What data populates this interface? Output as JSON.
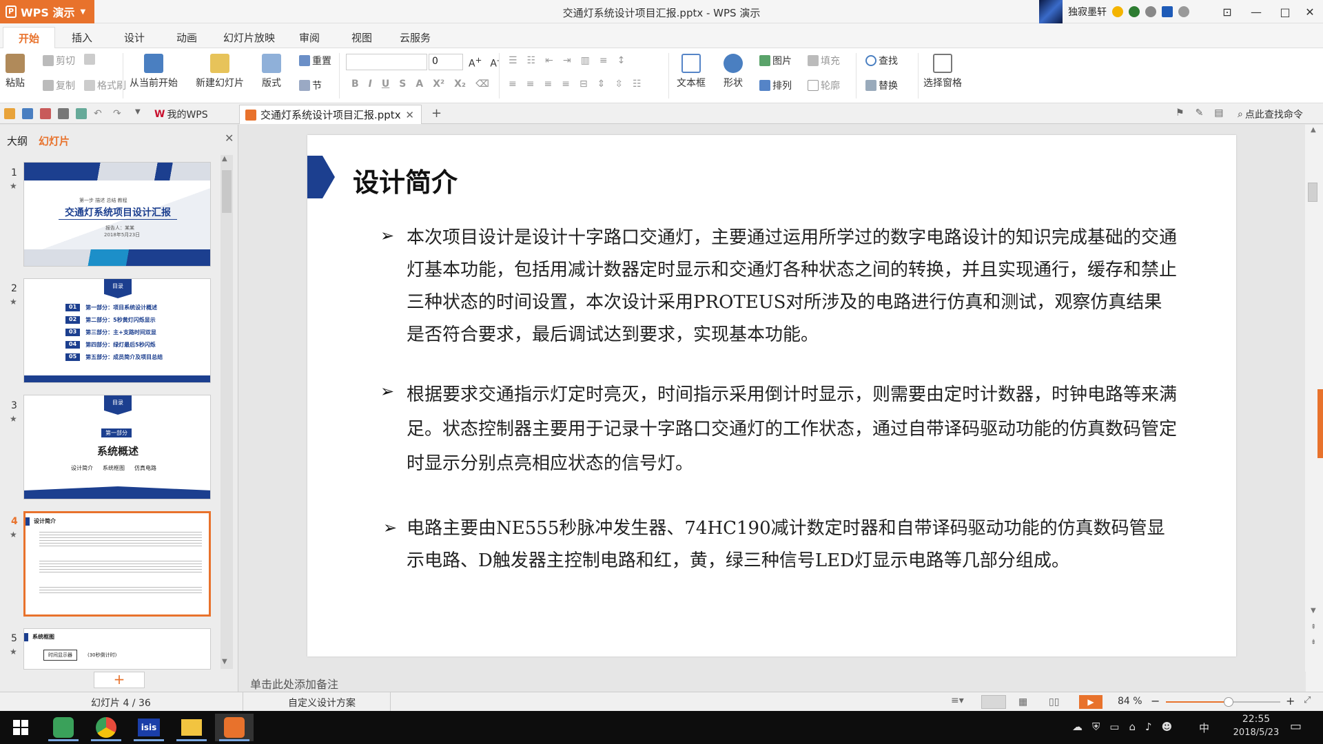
{
  "app": {
    "name": "WPS 演示",
    "window_title": "交通灯系统设计项目汇报.pptx - WPS 演示",
    "user": "独寂墨轩"
  },
  "colors": {
    "accent": "#e8722c",
    "slide_blue": "#1c3f8f"
  },
  "ribbon_tabs": [
    "开始",
    "插入",
    "设计",
    "动画",
    "幻灯片放映",
    "审阅",
    "视图",
    "云服务"
  ],
  "ribbon": {
    "paste": "粘贴",
    "cut": "剪切",
    "copy": "复制",
    "format_painter": "格式刷",
    "from_current": "从当前开始",
    "new_slide": "新建幻灯片",
    "layout": "版式",
    "reset": "重置",
    "section": "节",
    "font_size": "0",
    "text_box": "文本框",
    "shape": "形状",
    "picture": "图片",
    "fill": "填充",
    "arrange": "排列",
    "outline": "轮廓",
    "find": "查找",
    "replace": "替换",
    "selection_pane": "选择窗格"
  },
  "doc_tabs": {
    "home": "我的WPS",
    "current": "交通灯系统设计项目汇报.pptx",
    "search": "点此查找命令"
  },
  "panel": {
    "tab_outline": "大纲",
    "tab_slides": "幻灯片",
    "add": "+"
  },
  "thumbs": {
    "t1": {
      "title": "交通灯系统项目设计汇报",
      "sub": "第一步   描述   总结   教程",
      "info": "报告人：某某",
      "date": "2018年5月23日"
    },
    "t2": {
      "badge": "目录",
      "items": [
        {
          "n": "01",
          "t": "第一部分：项目系统设计概述"
        },
        {
          "n": "02",
          "t": "第二部分：5秒黄灯闪烁显示"
        },
        {
          "n": "03",
          "t": "第三部分：主+支路时间双显"
        },
        {
          "n": "04",
          "t": "第四部分：绿灯最后5秒闪烁"
        },
        {
          "n": "05",
          "t": "第五部分：成员简介及项目总结"
        }
      ]
    },
    "t3": {
      "badge": "目录",
      "part": "第一部分",
      "title": "系统概述",
      "items": [
        "设计简介",
        "系统框图",
        "仿真电路"
      ]
    },
    "t4": {
      "title": "设计简介"
    },
    "t5": {
      "title": "系统框图",
      "box": "时间显示器",
      "note": "(30秒倒计时)"
    }
  },
  "slide_numbers": [
    "1",
    "2",
    "3",
    "4",
    "5"
  ],
  "slide": {
    "title": "设计简介",
    "bullets": [
      "本次项目设计是设计十字路口交通灯，主要通过运用所学过的数字电路设计的知识完成基础的交通灯基本功能，包括用减计数器定时显示和交通灯各种状态之间的转换，并且实现通行，缓存和禁止三种状态的时间设置，本次设计采用PROTEUS对所涉及的电路进行仿真和测试，观察仿真结果是否符合要求，最后调试达到要求，实现基本功能。",
      "根据要求交通指示灯定时亮灭，时间指示采用倒计时显示，则需要由定时计数器，时钟电路等来满足。状态控制器主要用于记录十字路口交通灯的工作状态，通过自带译码驱动功能的仿真数码管定时显示分别点亮相应状态的信号灯。",
      "电路主要由NE555秒脉冲发生器、74HC190减计数定时器和自带译码驱动功能的仿真数码管显示电路、D触发器主控制电路和红，黄，绿三种信号LED灯显示电路等几部分组成。"
    ]
  },
  "notes_placeholder": "单击此处添加备注",
  "status": {
    "slide_counter": "幻灯片 4 / 36",
    "design": "自定义设计方案",
    "zoom": "84 %"
  },
  "zoom_level": 0.55,
  "taskbar": {
    "time": "22:55",
    "date": "2018/5/23",
    "ime": "中"
  }
}
